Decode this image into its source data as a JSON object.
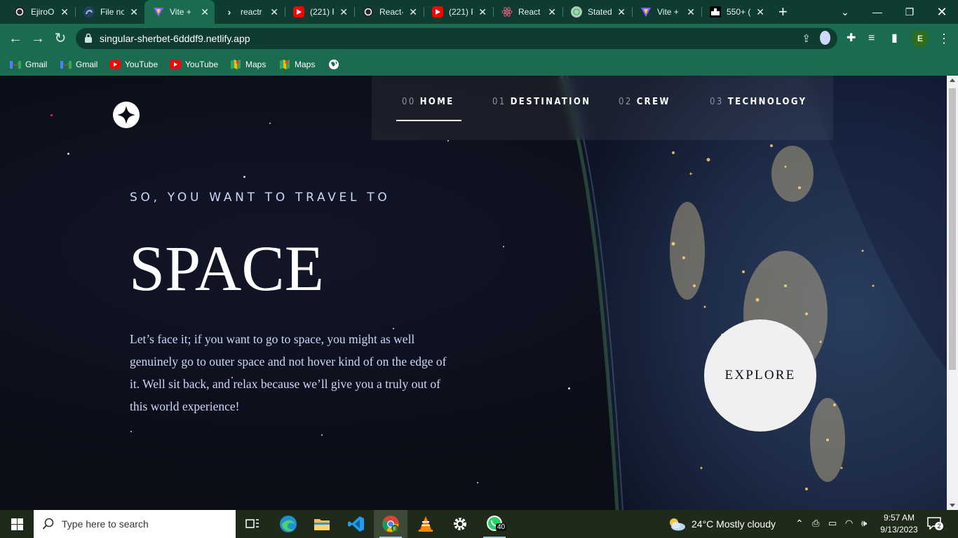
{
  "browser": {
    "tabs": [
      {
        "title": "EjiroO",
        "favicon": "github-icon",
        "color": "#24292f"
      },
      {
        "title": "File no",
        "favicon": "edge-file-icon",
        "color": "#2b6cb0"
      },
      {
        "title": "Vite +",
        "favicon": "vite-icon",
        "color": "#8a63ff",
        "active": true
      },
      {
        "title": "reactr",
        "favicon": "terminal-icon",
        "color": "#1e1e1e"
      },
      {
        "title": "(221) F",
        "favicon": "youtube-icon",
        "color": "#ff0000"
      },
      {
        "title": "React-",
        "favicon": "github-icon",
        "color": "#24292f"
      },
      {
        "title": "(221) F",
        "favicon": "youtube-icon",
        "color": "#ff0000"
      },
      {
        "title": "React |",
        "favicon": "react-icon",
        "color": "#61dafb"
      },
      {
        "title": "Stated",
        "favicon": "chatgpt-icon",
        "color": "#10a37f"
      },
      {
        "title": "Vite +",
        "favicon": "vite-icon",
        "color": "#8a63ff"
      },
      {
        "title": "550+ (",
        "favicon": "generic-site-icon",
        "color": "#000000"
      }
    ],
    "url": "singular-sherbet-6dddf9.netlify.app",
    "profile_initial": "E",
    "bookmarks": [
      {
        "label": "Gmail",
        "icon": "gmail-icon"
      },
      {
        "label": "Gmail",
        "icon": "gmail-icon"
      },
      {
        "label": "YouTube",
        "icon": "youtube-icon"
      },
      {
        "label": "YouTube",
        "icon": "youtube-icon"
      },
      {
        "label": "Maps",
        "icon": "maps-icon"
      },
      {
        "label": "Maps",
        "icon": "maps-icon"
      }
    ]
  },
  "site": {
    "nav": [
      {
        "num": "00",
        "label": "HOME",
        "active": true
      },
      {
        "num": "01",
        "label": "DESTINATION"
      },
      {
        "num": "02",
        "label": "CREW"
      },
      {
        "num": "03",
        "label": "TECHNOLOGY"
      }
    ],
    "eyebrow": "SO, YOU WANT TO TRAVEL TO",
    "headline": "SPACE",
    "paragraph": "Let’s face it; if you want to go to space, you might as well genuinely go to outer space and not hover kind of on the edge of it. Well sit back, and relax because we’ll give you a truly out of this world experience!",
    "explore_label": "EXPLORE"
  },
  "taskbar": {
    "search_placeholder": "Type here to search",
    "whatsapp_badge": "40",
    "weather": "24°C  Mostly cloudy",
    "time": "9:57 AM",
    "date": "9/13/2023",
    "notifications": "2"
  },
  "colors": {
    "chrome_dark": "#0f3c30",
    "chrome": "#1a6b4f",
    "space_bg": "#0b0d17",
    "accent_text": "#d0d6f9"
  }
}
